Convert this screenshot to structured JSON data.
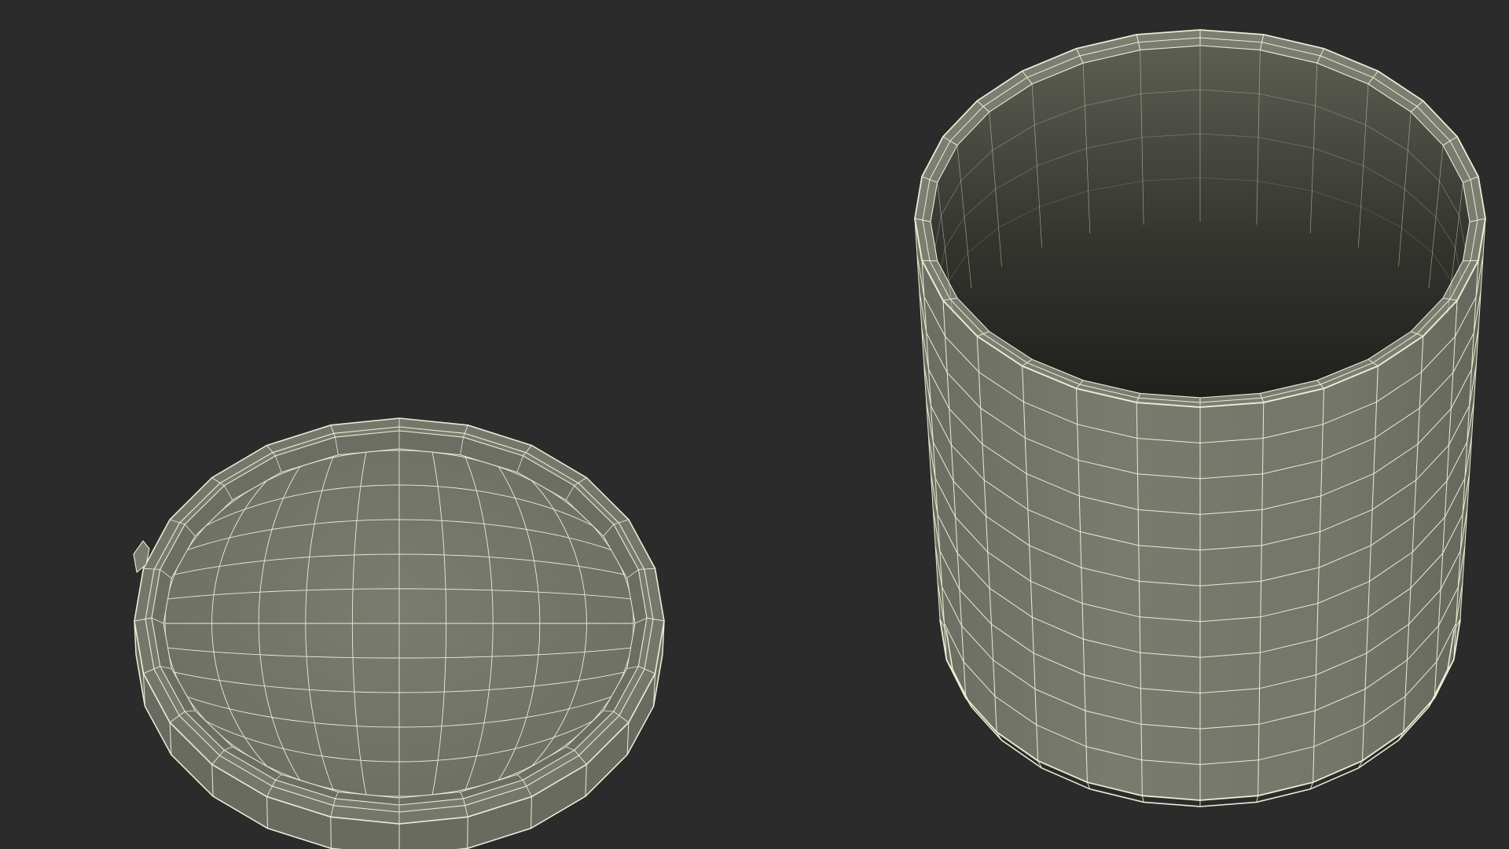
{
  "scene": {
    "background_color": "#2b2b2b",
    "surface_color": "#77786c",
    "surface_shadow_color": "#5d5e54",
    "interior_dark_color": "#232420",
    "interior_light_color": "#6f7065",
    "wire_color": "#ecebd4",
    "objects": [
      {
        "name": "lid",
        "label": "",
        "type": "cylinder lid (open top, shallow)",
        "radial_segments": 24,
        "inner_grid_rows": 10,
        "inner_grid_cols": 10
      },
      {
        "name": "container",
        "label": "",
        "type": "open cylinder jar",
        "radial_segments": 28,
        "height_segments": 11
      }
    ]
  }
}
